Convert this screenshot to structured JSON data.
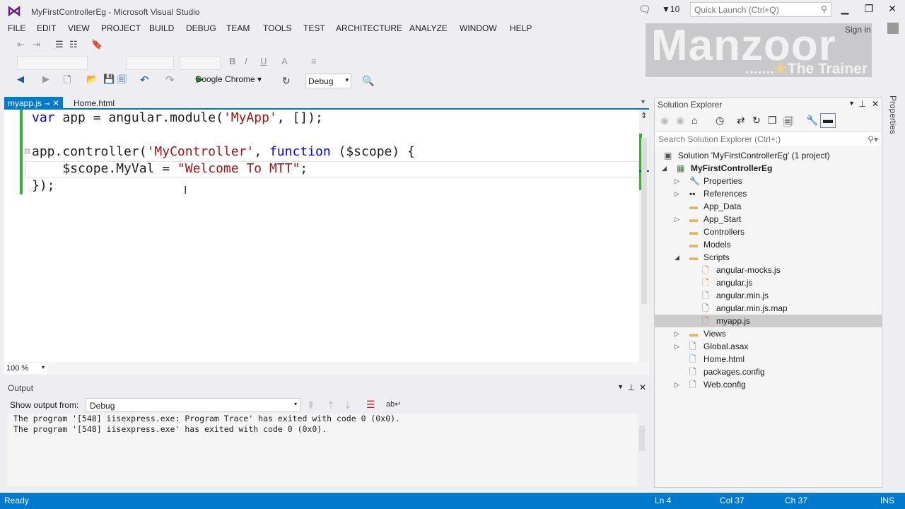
{
  "window": {
    "title": "MyFirstControllerEg - Microsoft Visual Studio",
    "notification_count": "10",
    "quick_launch_placeholder": "Quick Launch (Ctrl+Q)",
    "sign_in": "Sign in"
  },
  "watermark": {
    "line1": "Manzoor",
    "line2": ".......★The Trainer"
  },
  "menu": [
    "FILE",
    "EDIT",
    "VIEW",
    "PROJECT",
    "BUILD",
    "DEBUG",
    "TEAM",
    "TOOLS",
    "TEST",
    "ARCHITECTURE",
    "ANALYZE",
    "WINDOW",
    "HELP"
  ],
  "toolbar": {
    "target": "Google Chrome",
    "configuration": "Debug"
  },
  "tabs": [
    {
      "label": "myapp.js",
      "active": true
    },
    {
      "label": "Home.html",
      "active": false
    }
  ],
  "editor": {
    "lines": [
      [
        {
          "t": "var",
          "c": "kw"
        },
        {
          "t": " app = angular.module("
        },
        {
          "t": "'MyApp'",
          "c": "str"
        },
        {
          "t": ", []);"
        }
      ],
      [],
      [
        {
          "t": "app.controller("
        },
        {
          "t": "'MyController'",
          "c": "str"
        },
        {
          "t": ", "
        },
        {
          "t": "function",
          "c": "kw"
        },
        {
          "t": " ($scope) {"
        }
      ],
      [
        {
          "t": "    $scope.MyVal = "
        },
        {
          "t": "\"Welcome To MTT\"",
          "c": "str"
        },
        {
          "t": ";"
        }
      ],
      [
        {
          "t": "});"
        }
      ]
    ],
    "zoom": "100 %"
  },
  "output": {
    "title": "Output",
    "show_from_label": "Show output from:",
    "source": "Debug",
    "lines": [
      "The program '[548] iisexpress.exe: Program Trace' has exited with code 0 (0x0).",
      "The program '[548] iisexpress.exe' has exited with code 0 (0x0)."
    ]
  },
  "solution_explorer": {
    "title": "Solution Explorer",
    "search_placeholder": "Search Solution Explorer (Ctrl+;)",
    "items": [
      {
        "label": "Solution 'MyFirstControllerEg' (1 project)",
        "level": 0,
        "exp": "",
        "icon": "solution-icon"
      },
      {
        "label": "MyFirstControllerEg",
        "level": 0,
        "exp": "open",
        "icon": "project-icon",
        "bold": true
      },
      {
        "label": "Properties",
        "level": 1,
        "exp": "closed",
        "icon": "wrench-icon"
      },
      {
        "label": "References",
        "level": 1,
        "exp": "closed",
        "icon": "references-icon"
      },
      {
        "label": "App_Data",
        "level": 1,
        "exp": "",
        "icon": "folder-icon"
      },
      {
        "label": "App_Start",
        "level": 1,
        "exp": "closed",
        "icon": "folder-icon"
      },
      {
        "label": "Controllers",
        "level": 1,
        "exp": "",
        "icon": "folder-icon"
      },
      {
        "label": "Models",
        "level": 1,
        "exp": "",
        "icon": "folder-icon"
      },
      {
        "label": "Scripts",
        "level": 1,
        "exp": "open",
        "icon": "folder-icon"
      },
      {
        "label": "angular-mocks.js",
        "level": 2,
        "exp": "",
        "icon": "js-file-icon"
      },
      {
        "label": "angular.js",
        "level": 2,
        "exp": "",
        "icon": "js-file-icon"
      },
      {
        "label": "angular.min.js",
        "level": 2,
        "exp": "",
        "icon": "js-file-icon"
      },
      {
        "label": "angular.min.js.map",
        "level": 2,
        "exp": "",
        "icon": "file-icon"
      },
      {
        "label": "myapp.js",
        "level": 2,
        "exp": "",
        "icon": "js-file-icon",
        "selected": true
      },
      {
        "label": "Views",
        "level": 1,
        "exp": "closed",
        "icon": "folder-icon"
      },
      {
        "label": "Global.asax",
        "level": 1,
        "exp": "closed",
        "icon": "globe-file-icon"
      },
      {
        "label": "Home.html",
        "level": 1,
        "exp": "",
        "icon": "html-file-icon"
      },
      {
        "label": "packages.config",
        "level": 1,
        "exp": "",
        "icon": "config-file-icon"
      },
      {
        "label": "Web.config",
        "level": 1,
        "exp": "closed",
        "icon": "config-file-icon"
      }
    ]
  },
  "properties_tab": "Properties",
  "status": {
    "text": "Ready",
    "ln": "Ln 4",
    "col": "Col 37",
    "ch": "Ch 37",
    "mode": "INS"
  },
  "colors": {
    "accent": "#007acc",
    "keyword": "#0000ff",
    "string": "#a31515",
    "vs_purple": "#68217a"
  }
}
